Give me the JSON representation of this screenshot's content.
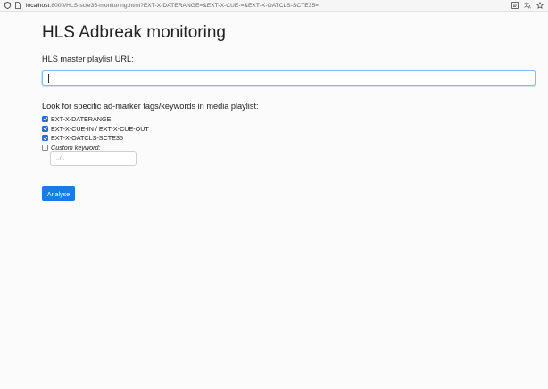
{
  "browser": {
    "url_host": "localhost",
    "url_rest": ":8000/HLS-scte35-monitoring.html?EXT-X-DATERANGE=&EXT-X-CUE-=&EXT-X-OATCLS-SCTE35="
  },
  "page": {
    "title": "HLS Adbreak monitoring",
    "url_label": "HLS master playlist URL:",
    "url_value": "",
    "keywords_label": "Look for specific ad-marker tags/keywords in media playlist:",
    "options": [
      {
        "label": "EXT-X-DATERANGE",
        "checked": true
      },
      {
        "label": "EXT-X-CUE-IN / EXT-X-CUE-OUT",
        "checked": true
      },
      {
        "label": "EXT-X-OATCLS-SCTE35",
        "checked": true
      },
      {
        "label": "Custom keyword:",
        "checked": false,
        "italic": true
      }
    ],
    "custom_placeholder": "../..",
    "analyse_label": "Analyse"
  },
  "colors": {
    "accent": "#1b7be0",
    "checkbox": "#2a6bd6"
  }
}
